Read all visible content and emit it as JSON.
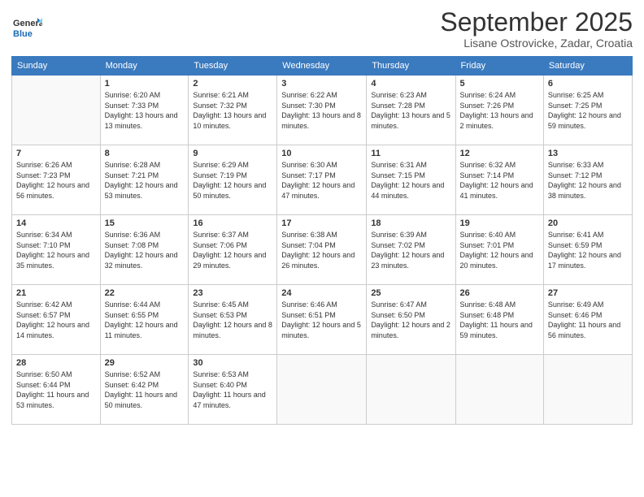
{
  "header": {
    "logo_general": "General",
    "logo_blue": "Blue",
    "month_title": "September 2025",
    "location": "Lisane Ostrovicke, Zadar, Croatia"
  },
  "days_of_week": [
    "Sunday",
    "Monday",
    "Tuesday",
    "Wednesday",
    "Thursday",
    "Friday",
    "Saturday"
  ],
  "weeks": [
    [
      {
        "day": "",
        "sunrise": "",
        "sunset": "",
        "daylight": ""
      },
      {
        "day": "1",
        "sunrise": "Sunrise: 6:20 AM",
        "sunset": "Sunset: 7:33 PM",
        "daylight": "Daylight: 13 hours and 13 minutes."
      },
      {
        "day": "2",
        "sunrise": "Sunrise: 6:21 AM",
        "sunset": "Sunset: 7:32 PM",
        "daylight": "Daylight: 13 hours and 10 minutes."
      },
      {
        "day": "3",
        "sunrise": "Sunrise: 6:22 AM",
        "sunset": "Sunset: 7:30 PM",
        "daylight": "Daylight: 13 hours and 8 minutes."
      },
      {
        "day": "4",
        "sunrise": "Sunrise: 6:23 AM",
        "sunset": "Sunset: 7:28 PM",
        "daylight": "Daylight: 13 hours and 5 minutes."
      },
      {
        "day": "5",
        "sunrise": "Sunrise: 6:24 AM",
        "sunset": "Sunset: 7:26 PM",
        "daylight": "Daylight: 13 hours and 2 minutes."
      },
      {
        "day": "6",
        "sunrise": "Sunrise: 6:25 AM",
        "sunset": "Sunset: 7:25 PM",
        "daylight": "Daylight: 12 hours and 59 minutes."
      }
    ],
    [
      {
        "day": "7",
        "sunrise": "Sunrise: 6:26 AM",
        "sunset": "Sunset: 7:23 PM",
        "daylight": "Daylight: 12 hours and 56 minutes."
      },
      {
        "day": "8",
        "sunrise": "Sunrise: 6:28 AM",
        "sunset": "Sunset: 7:21 PM",
        "daylight": "Daylight: 12 hours and 53 minutes."
      },
      {
        "day": "9",
        "sunrise": "Sunrise: 6:29 AM",
        "sunset": "Sunset: 7:19 PM",
        "daylight": "Daylight: 12 hours and 50 minutes."
      },
      {
        "day": "10",
        "sunrise": "Sunrise: 6:30 AM",
        "sunset": "Sunset: 7:17 PM",
        "daylight": "Daylight: 12 hours and 47 minutes."
      },
      {
        "day": "11",
        "sunrise": "Sunrise: 6:31 AM",
        "sunset": "Sunset: 7:15 PM",
        "daylight": "Daylight: 12 hours and 44 minutes."
      },
      {
        "day": "12",
        "sunrise": "Sunrise: 6:32 AM",
        "sunset": "Sunset: 7:14 PM",
        "daylight": "Daylight: 12 hours and 41 minutes."
      },
      {
        "day": "13",
        "sunrise": "Sunrise: 6:33 AM",
        "sunset": "Sunset: 7:12 PM",
        "daylight": "Daylight: 12 hours and 38 minutes."
      }
    ],
    [
      {
        "day": "14",
        "sunrise": "Sunrise: 6:34 AM",
        "sunset": "Sunset: 7:10 PM",
        "daylight": "Daylight: 12 hours and 35 minutes."
      },
      {
        "day": "15",
        "sunrise": "Sunrise: 6:36 AM",
        "sunset": "Sunset: 7:08 PM",
        "daylight": "Daylight: 12 hours and 32 minutes."
      },
      {
        "day": "16",
        "sunrise": "Sunrise: 6:37 AM",
        "sunset": "Sunset: 7:06 PM",
        "daylight": "Daylight: 12 hours and 29 minutes."
      },
      {
        "day": "17",
        "sunrise": "Sunrise: 6:38 AM",
        "sunset": "Sunset: 7:04 PM",
        "daylight": "Daylight: 12 hours and 26 minutes."
      },
      {
        "day": "18",
        "sunrise": "Sunrise: 6:39 AM",
        "sunset": "Sunset: 7:02 PM",
        "daylight": "Daylight: 12 hours and 23 minutes."
      },
      {
        "day": "19",
        "sunrise": "Sunrise: 6:40 AM",
        "sunset": "Sunset: 7:01 PM",
        "daylight": "Daylight: 12 hours and 20 minutes."
      },
      {
        "day": "20",
        "sunrise": "Sunrise: 6:41 AM",
        "sunset": "Sunset: 6:59 PM",
        "daylight": "Daylight: 12 hours and 17 minutes."
      }
    ],
    [
      {
        "day": "21",
        "sunrise": "Sunrise: 6:42 AM",
        "sunset": "Sunset: 6:57 PM",
        "daylight": "Daylight: 12 hours and 14 minutes."
      },
      {
        "day": "22",
        "sunrise": "Sunrise: 6:44 AM",
        "sunset": "Sunset: 6:55 PM",
        "daylight": "Daylight: 12 hours and 11 minutes."
      },
      {
        "day": "23",
        "sunrise": "Sunrise: 6:45 AM",
        "sunset": "Sunset: 6:53 PM",
        "daylight": "Daylight: 12 hours and 8 minutes."
      },
      {
        "day": "24",
        "sunrise": "Sunrise: 6:46 AM",
        "sunset": "Sunset: 6:51 PM",
        "daylight": "Daylight: 12 hours and 5 minutes."
      },
      {
        "day": "25",
        "sunrise": "Sunrise: 6:47 AM",
        "sunset": "Sunset: 6:50 PM",
        "daylight": "Daylight: 12 hours and 2 minutes."
      },
      {
        "day": "26",
        "sunrise": "Sunrise: 6:48 AM",
        "sunset": "Sunset: 6:48 PM",
        "daylight": "Daylight: 11 hours and 59 minutes."
      },
      {
        "day": "27",
        "sunrise": "Sunrise: 6:49 AM",
        "sunset": "Sunset: 6:46 PM",
        "daylight": "Daylight: 11 hours and 56 minutes."
      }
    ],
    [
      {
        "day": "28",
        "sunrise": "Sunrise: 6:50 AM",
        "sunset": "Sunset: 6:44 PM",
        "daylight": "Daylight: 11 hours and 53 minutes."
      },
      {
        "day": "29",
        "sunrise": "Sunrise: 6:52 AM",
        "sunset": "Sunset: 6:42 PM",
        "daylight": "Daylight: 11 hours and 50 minutes."
      },
      {
        "day": "30",
        "sunrise": "Sunrise: 6:53 AM",
        "sunset": "Sunset: 6:40 PM",
        "daylight": "Daylight: 11 hours and 47 minutes."
      },
      {
        "day": "",
        "sunrise": "",
        "sunset": "",
        "daylight": ""
      },
      {
        "day": "",
        "sunrise": "",
        "sunset": "",
        "daylight": ""
      },
      {
        "day": "",
        "sunrise": "",
        "sunset": "",
        "daylight": ""
      },
      {
        "day": "",
        "sunrise": "",
        "sunset": "",
        "daylight": ""
      }
    ]
  ]
}
